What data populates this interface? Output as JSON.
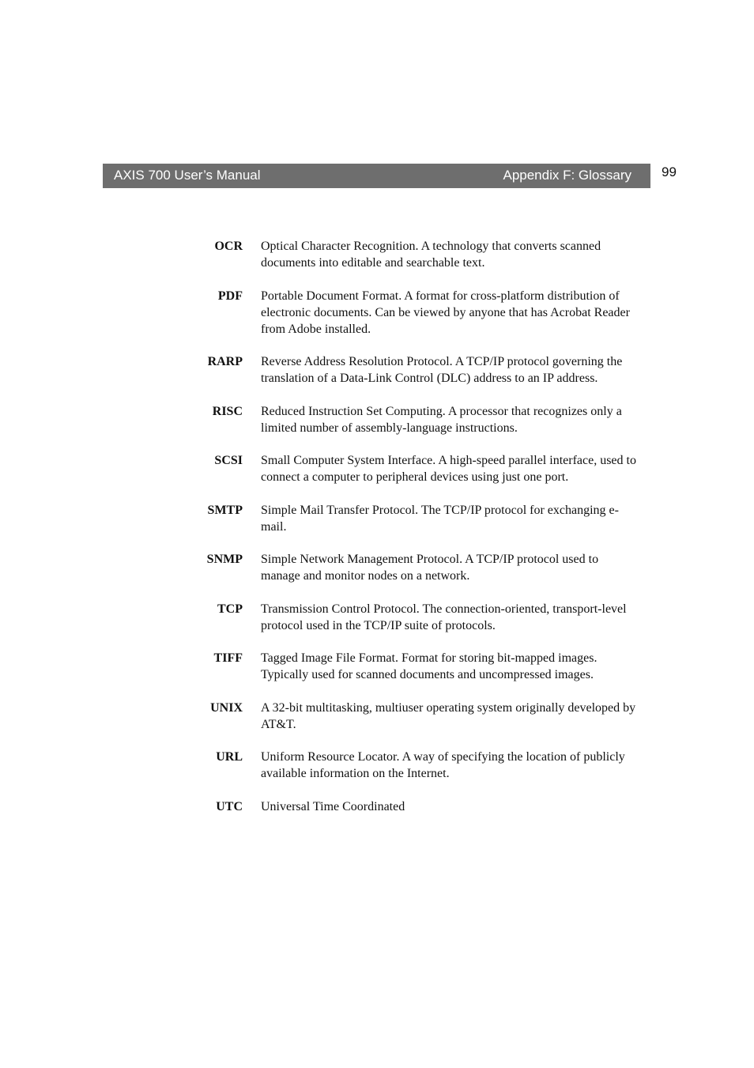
{
  "header": {
    "manual_title": "AXIS 700 User’s Manual",
    "section_title": "Appendix F: Glossary",
    "page_number": "99",
    "bar_color": "#6e6e6e"
  },
  "glossary": {
    "entries": [
      {
        "term": "OCR",
        "definition": "Optical Character Recognition. A technology that converts scanned documents into editable and searchable text."
      },
      {
        "term": "PDF",
        "definition": "Portable Document Format. A format for cross-platform distribution of electronic documents. Can be viewed by anyone that has Acrobat Reader from Adobe installed."
      },
      {
        "term": "RARP",
        "definition": "Reverse Address Resolution Protocol. A TCP/IP protocol governing the translation of a Data-Link Control (DLC) address to an IP address."
      },
      {
        "term": "RISC",
        "definition": "Reduced Instruction Set Computing. A processor that recognizes only a limited number of assembly-language instructions."
      },
      {
        "term": "SCSI",
        "definition": "Small Computer System Interface. A high-speed parallel interface, used to connect a computer to peripheral devices using just one port."
      },
      {
        "term": "SMTP",
        "definition": "Simple Mail Transfer Protocol. The TCP/IP protocol for exchanging e-mail."
      },
      {
        "term": "SNMP",
        "definition": "Simple Network Management Protocol. A TCP/IP protocol used to manage and monitor nodes on a network."
      },
      {
        "term": "TCP",
        "definition": "Transmission Control Protocol. The connection-oriented, transport-level protocol used in the TCP/IP suite of protocols."
      },
      {
        "term": "TIFF",
        "definition": "Tagged Image File Format. Format for storing bit-mapped images. Typically used for scanned documents and uncompressed images."
      },
      {
        "term": "UNIX",
        "definition": "A 32-bit multitasking, multiuser operating system originally developed by AT&T."
      },
      {
        "term": "URL",
        "definition": "Uniform Resource Locator. A way of specifying the location of publicly available information on the Internet."
      },
      {
        "term": "UTC",
        "definition": "Universal Time Coordinated"
      }
    ]
  }
}
